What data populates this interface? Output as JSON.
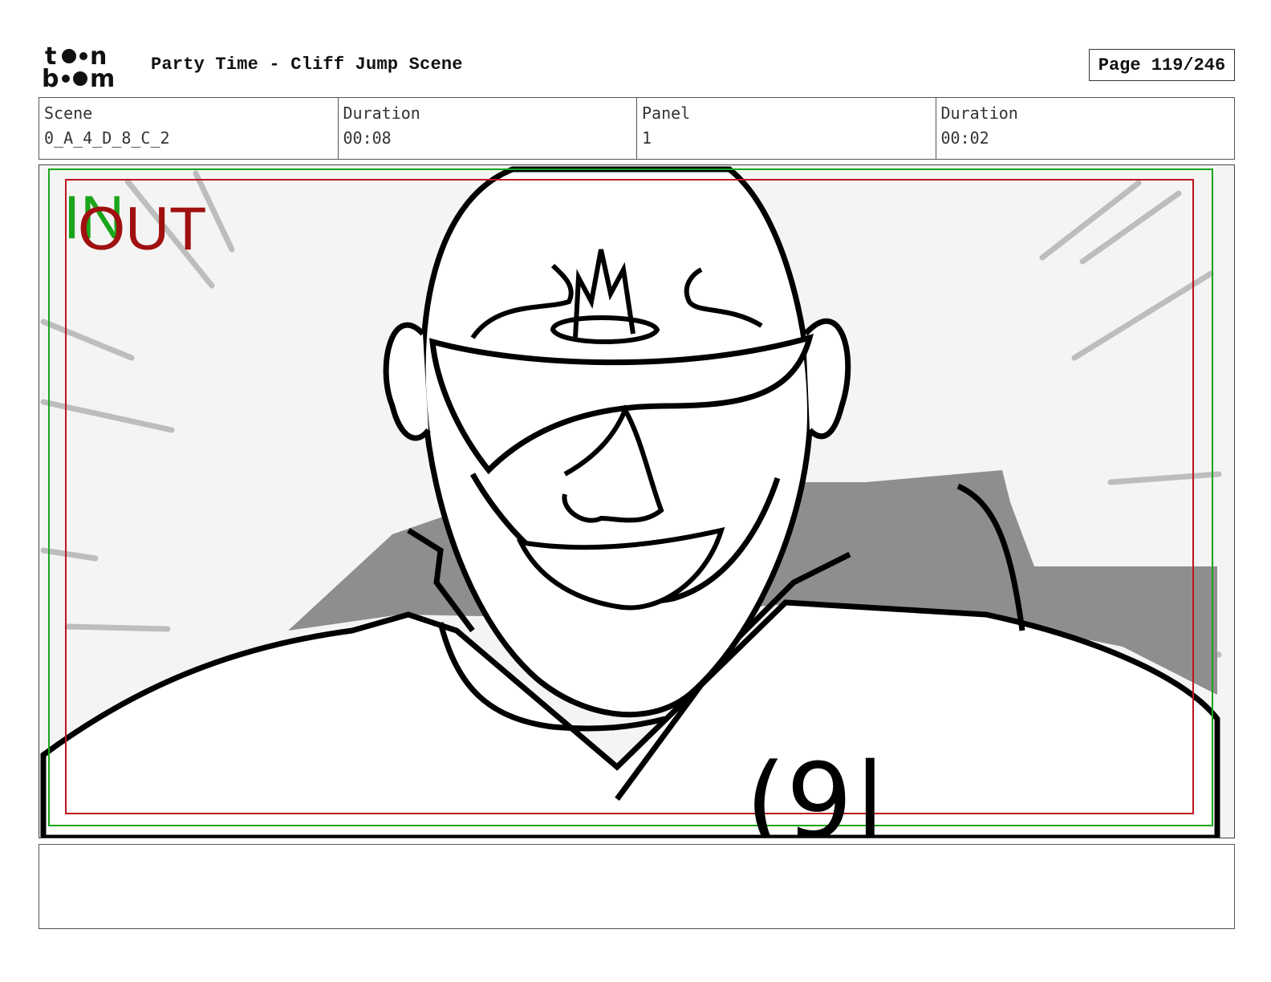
{
  "header": {
    "title": "Party Time - Cliff Jump Scene",
    "page_indicator": "Page 119/246"
  },
  "info": {
    "scene_label": "Scene",
    "scene_value": "0_A_4_D_8_C_2",
    "scene_duration_label": "Duration",
    "scene_duration_value": "00:08",
    "panel_label": "Panel",
    "panel_value": "1",
    "panel_duration_label": "Duration",
    "panel_duration_value": "00:02"
  },
  "panel": {
    "in_marker": "IN",
    "out_marker": "OUT",
    "shirt_text": "(9|",
    "safe_frame_color": "#1aa51a",
    "title_safe_color": "#c0141c"
  },
  "notes": {}
}
